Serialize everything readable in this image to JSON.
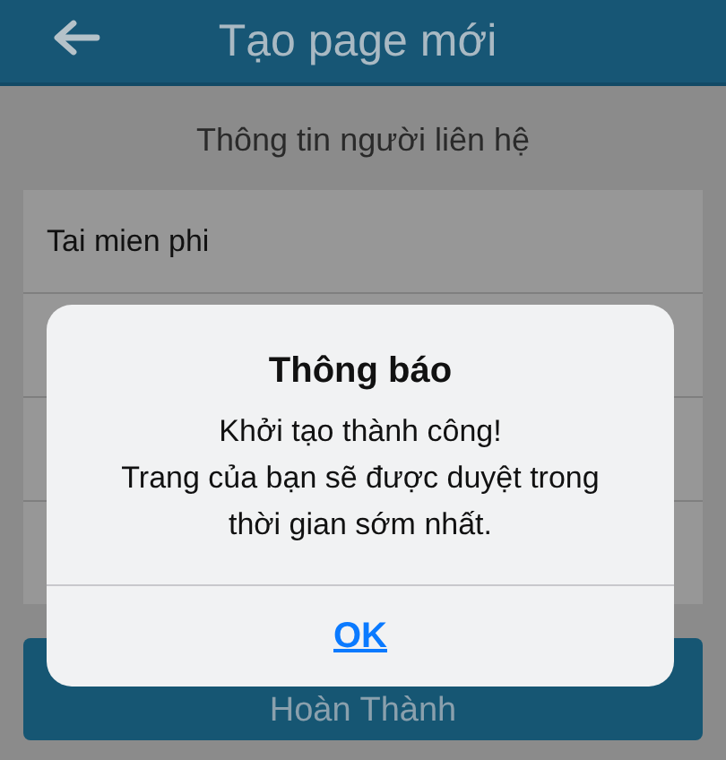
{
  "header": {
    "title": "Tạo page mới"
  },
  "section_title": "Thông tin người liên hệ",
  "fields": [
    {
      "value": "Tai mien phi"
    }
  ],
  "submit_button": "Hoàn Thành",
  "alert": {
    "title": "Thông báo",
    "message": [
      "Khởi tạo thành công!",
      "Trang của bạn sẽ được duyệt trong thời gian sớm nhất."
    ],
    "buttons": [
      "OK"
    ]
  }
}
